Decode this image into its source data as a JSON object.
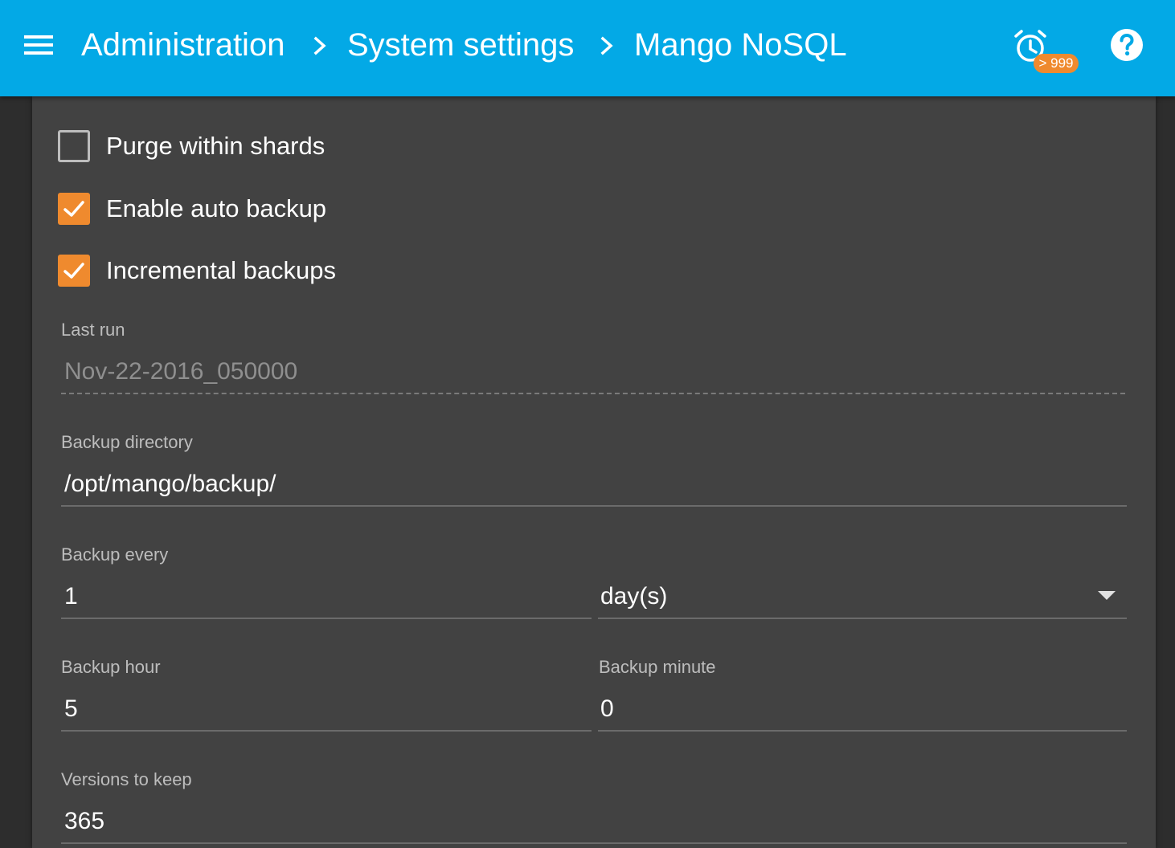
{
  "header": {
    "menu_icon": "menu-icon",
    "breadcrumb": [
      "Administration",
      "System settings",
      "Mango NoSQL"
    ],
    "separator_icon": "chevron-right-icon",
    "alarm_icon": "alarm-clock-icon",
    "alarm_badge": "> 999",
    "help_icon": "help-circle-icon",
    "bar_color": "#03a9e6",
    "badge_color": "#ef8a2e"
  },
  "settings": {
    "purge_within_shards": {
      "label": "Purge within shards",
      "checked": false
    },
    "enable_auto_backup": {
      "label": "Enable auto backup",
      "checked": true
    },
    "incremental_backups": {
      "label": "Incremental backups",
      "checked": true
    },
    "last_run": {
      "label": "Last run",
      "value": "Nov-22-2016_050000",
      "disabled": true
    },
    "backup_directory": {
      "label": "Backup directory",
      "value": "/opt/mango/backup/"
    },
    "backup_every": {
      "label": "Backup every",
      "value": "1",
      "unit": "day(s)"
    },
    "backup_hour": {
      "label": "Backup hour",
      "value": "5"
    },
    "backup_minute": {
      "label": "Backup minute",
      "value": "0"
    },
    "versions_to_keep": {
      "label": "Versions to keep",
      "value": "365"
    }
  },
  "colors": {
    "accent": "#ef8a2e",
    "panel": "#424242",
    "background": "#2d2d2d"
  }
}
